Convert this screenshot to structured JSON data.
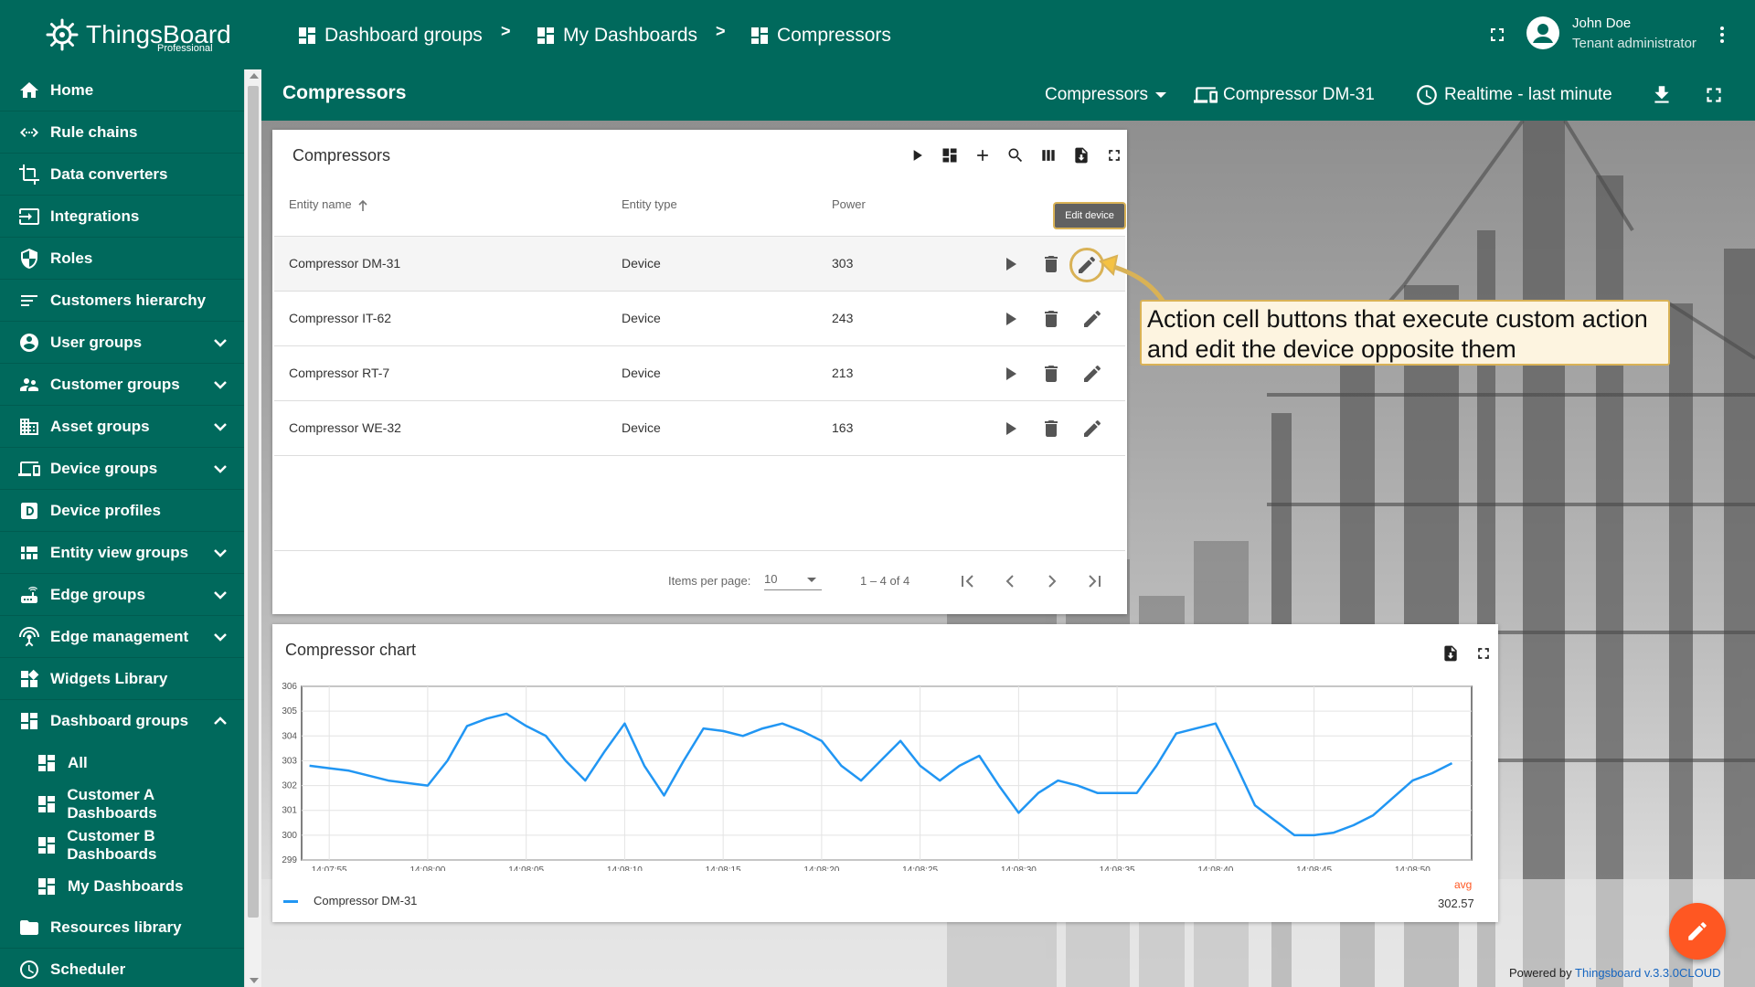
{
  "logo": {
    "name": "ThingsBoard",
    "edition": "Professional"
  },
  "breadcrumb": [
    {
      "label": "Dashboard groups"
    },
    {
      "label": "My Dashboards"
    },
    {
      "label": "Compressors"
    }
  ],
  "breadcrumb_separator": ">",
  "user": {
    "name": "John Doe",
    "role": "Tenant administrator"
  },
  "sidebar": {
    "items": [
      {
        "label": "Home",
        "icon": "home-icon"
      },
      {
        "label": "Rule chains",
        "icon": "rule-chains-icon"
      },
      {
        "label": "Data converters",
        "icon": "data-converters-icon"
      },
      {
        "label": "Integrations",
        "icon": "integrations-icon"
      },
      {
        "label": "Roles",
        "icon": "shield-icon"
      },
      {
        "label": "Customers hierarchy",
        "icon": "hierarchy-icon"
      },
      {
        "label": "User groups",
        "icon": "account-circle-icon",
        "expandable": true
      },
      {
        "label": "Customer groups",
        "icon": "supervisor-icon",
        "expandable": true
      },
      {
        "label": "Asset groups",
        "icon": "domain-icon",
        "expandable": true
      },
      {
        "label": "Device groups",
        "icon": "devices-icon",
        "expandable": true
      },
      {
        "label": "Device profiles",
        "icon": "device-profile-icon"
      },
      {
        "label": "Entity view groups",
        "icon": "view-quilt-icon",
        "expandable": true
      },
      {
        "label": "Edge groups",
        "icon": "router-icon",
        "expandable": true
      },
      {
        "label": "Edge management",
        "icon": "settings-input-antenna-icon",
        "expandable": true
      },
      {
        "label": "Widgets Library",
        "icon": "widgets-icon"
      },
      {
        "label": "Dashboard groups",
        "icon": "dashboard-icon",
        "expanded": true
      }
    ],
    "dashboard_sub": [
      {
        "label": "All"
      },
      {
        "label": "Customer A Dashboards"
      },
      {
        "label": "Customer B Dashboards"
      },
      {
        "label": "My Dashboards"
      }
    ],
    "bottom": [
      {
        "label": "Resources library",
        "icon": "folder-icon"
      },
      {
        "label": "Scheduler",
        "icon": "clock-icon"
      }
    ]
  },
  "dashboard_bar": {
    "title": "Compressors",
    "state_select": "Compressors",
    "entity": "Compressor DM-31",
    "timewindow": "Realtime - last minute"
  },
  "table_widget": {
    "title": "Compressors",
    "columns": [
      "Entity name",
      "Entity type",
      "Power"
    ],
    "rows": [
      {
        "name": "Compressor DM-31",
        "type": "Device",
        "power": "303"
      },
      {
        "name": "Compressor IT-62",
        "type": "Device",
        "power": "243"
      },
      {
        "name": "Compressor RT-7",
        "type": "Device",
        "power": "213"
      },
      {
        "name": "Compressor WE-32",
        "type": "Device",
        "power": "163"
      }
    ],
    "tooltip": "Edit device",
    "paginator": {
      "label": "Items per page:",
      "page_size": "10",
      "range": "1 – 4 of 4"
    }
  },
  "callout": {
    "text": "Action cell buttons that execute custom action and edit the device opposite them"
  },
  "chart_widget": {
    "title": "Compressor chart"
  },
  "chart_data": {
    "type": "line",
    "title": "Compressor chart",
    "xlabel": "",
    "ylabel": "",
    "ylim": [
      299,
      306
    ],
    "yticks": [
      299,
      300,
      301,
      302,
      303,
      304,
      305,
      306
    ],
    "xticks": [
      "14:07:55",
      "14:08:00",
      "14:08:05",
      "14:08:10",
      "14:08:15",
      "14:08:20",
      "14:08:25",
      "14:08:30",
      "14:08:35",
      "14:08:40",
      "14:08:45",
      "14:08:50"
    ],
    "grid": true,
    "series": [
      {
        "name": "Compressor DM-31",
        "color": "#2196f3",
        "x": [
          "14:07:54",
          "14:07:55",
          "14:07:56",
          "14:07:57",
          "14:07:58",
          "14:07:59",
          "14:08:00",
          "14:08:01",
          "14:08:02",
          "14:08:03",
          "14:08:04",
          "14:08:05",
          "14:08:06",
          "14:08:07",
          "14:08:08",
          "14:08:09",
          "14:08:10",
          "14:08:11",
          "14:08:12",
          "14:08:13",
          "14:08:14",
          "14:08:15",
          "14:08:16",
          "14:08:17",
          "14:08:18",
          "14:08:19",
          "14:08:20",
          "14:08:21",
          "14:08:22",
          "14:08:23",
          "14:08:24",
          "14:08:25",
          "14:08:26",
          "14:08:27",
          "14:08:28",
          "14:08:29",
          "14:08:30",
          "14:08:31",
          "14:08:32",
          "14:08:33",
          "14:08:34",
          "14:08:35",
          "14:08:36",
          "14:08:37",
          "14:08:38",
          "14:08:39",
          "14:08:40",
          "14:08:41",
          "14:08:42",
          "14:08:43",
          "14:08:44",
          "14:08:45",
          "14:08:46",
          "14:08:47",
          "14:08:48",
          "14:08:49",
          "14:08:50",
          "14:08:51",
          "14:08:52"
        ],
        "values": [
          302.8,
          302.7,
          302.6,
          302.4,
          302.2,
          302.1,
          302.0,
          303.0,
          304.4,
          304.7,
          304.9,
          304.4,
          304.0,
          303.0,
          302.2,
          303.4,
          304.5,
          302.8,
          301.6,
          303.0,
          304.3,
          304.2,
          304.0,
          304.3,
          304.5,
          304.2,
          303.8,
          302.8,
          302.2,
          303.0,
          303.8,
          302.8,
          302.2,
          302.8,
          303.2,
          302.0,
          300.9,
          301.7,
          302.2,
          302.0,
          301.7,
          301.7,
          301.7,
          302.8,
          304.1,
          304.3,
          304.5,
          302.9,
          301.2,
          300.6,
          300.0,
          300.0,
          300.1,
          300.4,
          300.8,
          301.5,
          302.2,
          302.5,
          302.9
        ]
      }
    ],
    "legend": {
      "position": "bottom",
      "aggregate_label": "avg",
      "aggregate_value": "302.57"
    }
  },
  "footer": {
    "prefix": "Powered by",
    "link": "Thingsboard v.3.3.0CLOUD"
  },
  "colors": {
    "primary": "#00695c",
    "accent": "#ff5722",
    "series": "#2196f3",
    "highlight": "#d9b256"
  }
}
